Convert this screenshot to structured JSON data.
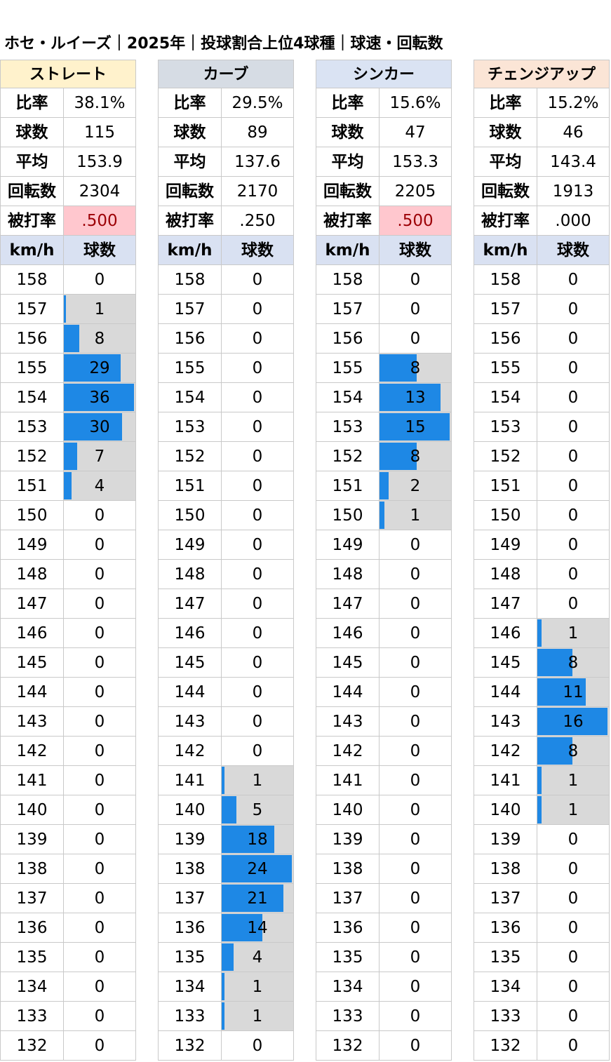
{
  "title": "ホセ・ルイーズ｜2025年｜投球割合上位4球種｜球速・回転数",
  "labels": {
    "ratio": "比率",
    "count": "球数",
    "avg": "平均",
    "spin": "回転数",
    "avg_against": "被打率",
    "kmh": "km/h",
    "pitches": "球数"
  },
  "colors": {
    "bar": "#1e88e5",
    "bar_bg": "#d9d9d9",
    "col_header": "#d9e1f2",
    "high_avg_bg": "#ffc7ce",
    "high_avg_text": "#9c0006"
  },
  "speeds": [
    158,
    157,
    156,
    155,
    154,
    153,
    152,
    151,
    150,
    149,
    148,
    147,
    146,
    145,
    144,
    143,
    142,
    141,
    140,
    139,
    138,
    137,
    136,
    135,
    134,
    133,
    132
  ],
  "chart_data": {
    "type": "bar",
    "orientation": "horizontal",
    "categories": [
      158,
      157,
      156,
      155,
      154,
      153,
      152,
      151,
      150,
      149,
      148,
      147,
      146,
      145,
      144,
      143,
      142,
      141,
      140,
      139,
      138,
      137,
      136,
      135,
      134,
      133,
      132
    ],
    "series": [
      {
        "name": "ストレート",
        "header_color": "#fff2cc",
        "ratio": "38.1%",
        "count": "115",
        "avg": "153.9",
        "spin": "2304",
        "avg_against": ".500",
        "avg_against_high": true,
        "values": [
          0,
          1,
          8,
          29,
          36,
          30,
          7,
          4,
          0,
          0,
          0,
          0,
          0,
          0,
          0,
          0,
          0,
          0,
          0,
          0,
          0,
          0,
          0,
          0,
          0,
          0,
          0
        ]
      },
      {
        "name": "カーブ",
        "header_color": "#d6dce4",
        "ratio": "29.5%",
        "count": "89",
        "avg": "137.6",
        "spin": "2170",
        "avg_against": ".250",
        "avg_against_high": false,
        "values": [
          0,
          0,
          0,
          0,
          0,
          0,
          0,
          0,
          0,
          0,
          0,
          0,
          0,
          0,
          0,
          0,
          0,
          1,
          5,
          18,
          24,
          21,
          14,
          4,
          1,
          1,
          0
        ]
      },
      {
        "name": "シンカー",
        "header_color": "#dae3f3",
        "ratio": "15.6%",
        "count": "47",
        "avg": "153.3",
        "spin": "2205",
        "avg_against": ".500",
        "avg_against_high": true,
        "values": [
          0,
          0,
          0,
          8,
          13,
          15,
          8,
          2,
          1,
          0,
          0,
          0,
          0,
          0,
          0,
          0,
          0,
          0,
          0,
          0,
          0,
          0,
          0,
          0,
          0,
          0,
          0
        ]
      },
      {
        "name": "チェンジアップ",
        "header_color": "#fbe5d6",
        "ratio": "15.2%",
        "count": "46",
        "avg": "143.4",
        "spin": "1913",
        "avg_against": ".000",
        "avg_against_high": false,
        "values": [
          0,
          0,
          0,
          0,
          0,
          0,
          0,
          0,
          0,
          0,
          0,
          0,
          1,
          8,
          11,
          16,
          8,
          1,
          1,
          0,
          0,
          0,
          0,
          0,
          0,
          0,
          0
        ]
      }
    ]
  }
}
